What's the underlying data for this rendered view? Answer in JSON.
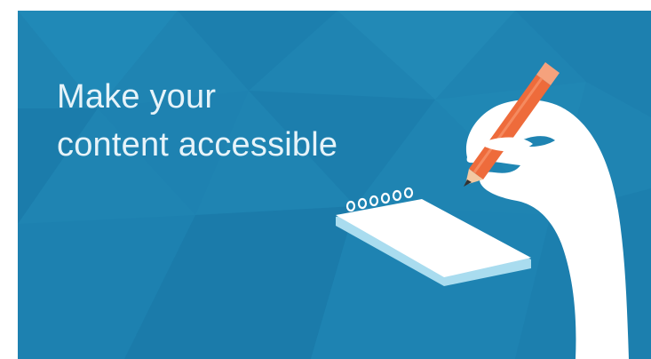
{
  "banner": {
    "headline_line1": "Make your",
    "headline_line2": "content accessible",
    "background_color": "#1f84b2",
    "text_color": "#e6f3f9",
    "illustration": {
      "hand": "hand-icon",
      "pencil": "pencil-icon",
      "notepad": "notepad-icon",
      "pencil_color": "#ee6b3b",
      "notepad_color": "#ffffff",
      "notepad_edge_color": "#a9dcef"
    }
  }
}
